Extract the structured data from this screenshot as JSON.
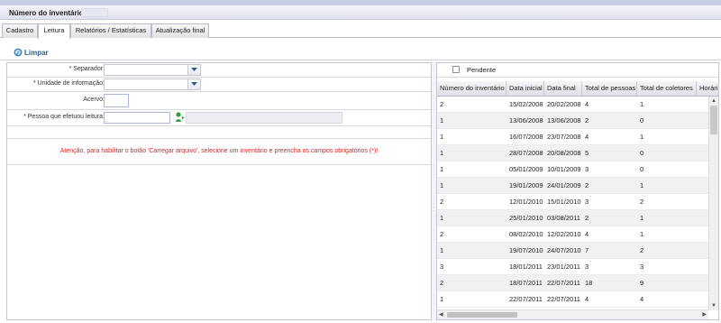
{
  "inventory": {
    "label": "Número do inventário"
  },
  "tabs": [
    {
      "label": "Cadastro"
    },
    {
      "label": "Leitura"
    },
    {
      "label": "Relatórios / Estatísticas"
    },
    {
      "label": "Atualização final"
    }
  ],
  "toolbar": {
    "clear_label": "Limpar",
    "clear_icon": "refresh-icon"
  },
  "form": {
    "separator_label": "* Separador:",
    "unit_label": "* Unidade de informação:",
    "collection_label": "Acervo:",
    "reader_label": "* Pessoa que efetuou leitura:",
    "warning": "Atenção, para habilitar o botão 'Carregar arquivo', selecione um inventário e preencha os campos obrigatórios (*)!"
  },
  "filter": {
    "pending_label": "Pendente"
  },
  "grid": {
    "columns": [
      "Número do inventário",
      "Data inicial",
      "Data final",
      "Total de pessoas",
      "Total de coletores",
      "Horári"
    ],
    "rows": [
      [
        "2",
        "15/02/2008",
        "20/02/2008",
        "4",
        "1"
      ],
      [
        "1",
        "13/06/2008",
        "13/06/2008",
        "2",
        "0"
      ],
      [
        "1",
        "16/07/2008",
        "23/07/2008",
        "4",
        "1"
      ],
      [
        "1",
        "28/07/2008",
        "20/08/2008",
        "5",
        "0"
      ],
      [
        "1",
        "05/01/2009",
        "10/01/2009",
        "3",
        "0"
      ],
      [
        "1",
        "19/01/2009",
        "24/01/2009",
        "2",
        "1"
      ],
      [
        "2",
        "12/01/2010",
        "15/01/2010",
        "3",
        "2"
      ],
      [
        "1",
        "25/01/2010",
        "03/08/2011",
        "2",
        "1"
      ],
      [
        "2",
        "08/02/2010",
        "12/02/2010",
        "4",
        "1"
      ],
      [
        "1",
        "19/07/2010",
        "24/07/2010",
        "7",
        "2"
      ],
      [
        "3",
        "18/01/2011",
        "23/01/2011",
        "3",
        "3"
      ],
      [
        "2",
        "18/07/2011",
        "22/07/2011",
        "18",
        "9"
      ],
      [
        "1",
        "22/07/2011",
        "22/07/2011",
        "4",
        "4"
      ]
    ]
  },
  "colors": {
    "warning": "#e02020",
    "accent": "#2b5f8f",
    "header_bar": "#c9cde3"
  }
}
